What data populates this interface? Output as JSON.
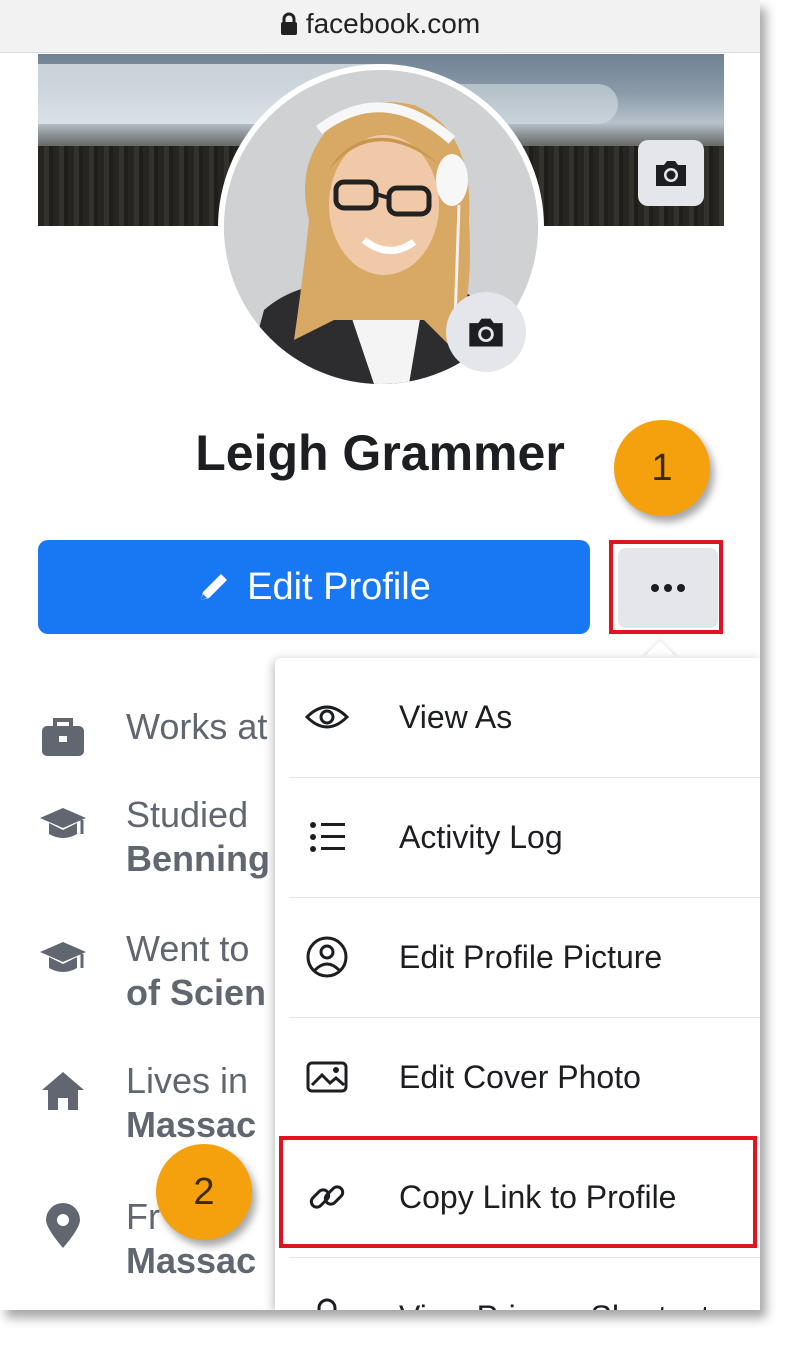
{
  "browser": {
    "url": "facebook.com",
    "lock_icon": "lock-icon"
  },
  "profile": {
    "name": "Leigh Grammer",
    "edit_profile_label": "Edit Profile",
    "more_label": "···"
  },
  "callouts": {
    "one": "1",
    "two": "2"
  },
  "intro": {
    "items": [
      {
        "icon": "briefcase-icon",
        "line1": "Works at",
        "line2": ""
      },
      {
        "icon": "graduation-cap-icon",
        "line1": "Studied",
        "line2": "Benning"
      },
      {
        "icon": "graduation-cap-icon",
        "line1": "Went to",
        "line2": "of Scien"
      },
      {
        "icon": "home-icon",
        "line1": "Lives in",
        "line2": "Massac"
      },
      {
        "icon": "location-pin-icon",
        "line1": "Fr",
        "line2": "Massac"
      }
    ]
  },
  "menu": {
    "items": [
      {
        "icon": "eye-icon",
        "label": "View As"
      },
      {
        "icon": "list-icon",
        "label": "Activity Log"
      },
      {
        "icon": "user-circle-icon",
        "label": "Edit Profile Picture"
      },
      {
        "icon": "image-icon",
        "label": "Edit Cover Photo"
      },
      {
        "icon": "link-icon",
        "label": "Copy Link to Profile"
      },
      {
        "icon": "lock-icon",
        "label": "View Privacy Shortcuts"
      }
    ]
  },
  "colors": {
    "primary": "#1877f2",
    "highlight": "#e0141e",
    "callout": "#f5a10e"
  }
}
